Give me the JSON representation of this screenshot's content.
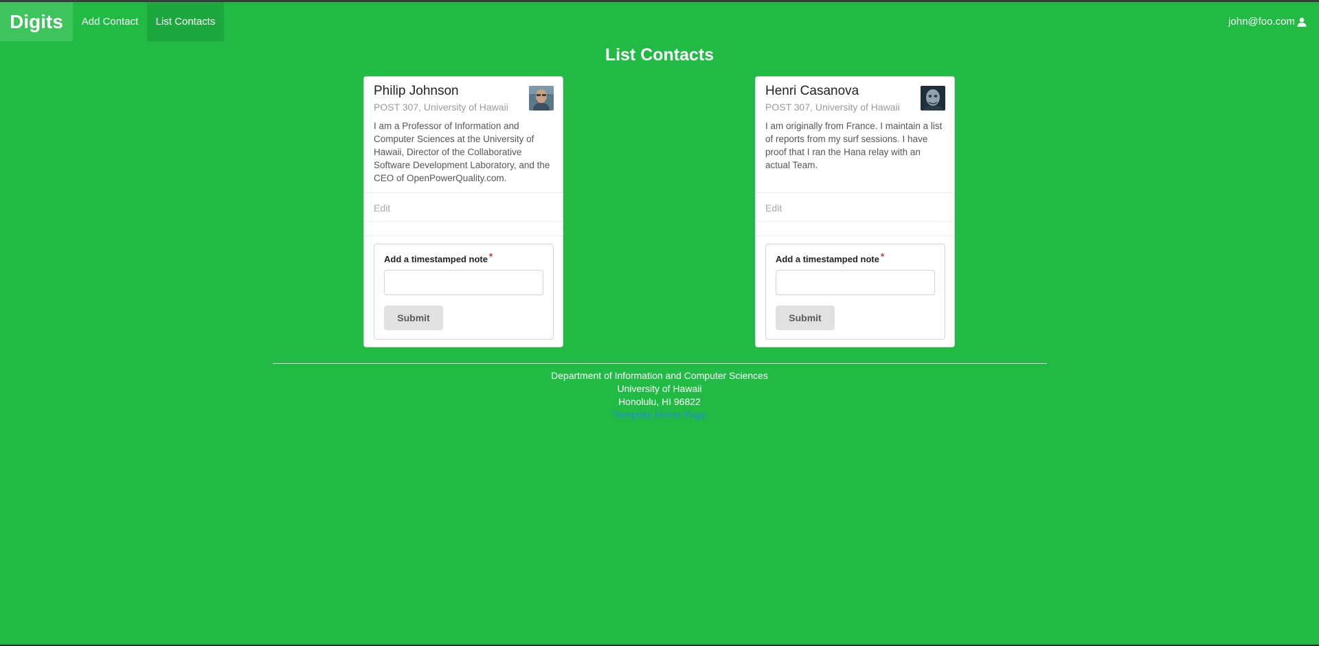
{
  "navbar": {
    "brand": "Digits",
    "items": [
      {
        "label": "Add Contact"
      },
      {
        "label": "List Contacts"
      }
    ],
    "user_email": "john@foo.com",
    "user_icon": "user-icon"
  },
  "page": {
    "title": "List Contacts"
  },
  "contacts": [
    {
      "name": "Philip Johnson",
      "address": "POST 307, University of Hawaii",
      "description": "I am a Professor of Information and Computer Sciences at the University of Hawaii, Director of the Collaborative Software Development Laboratory, and the CEO of OpenPowerQuality.com.",
      "edit_label": "Edit",
      "note_label": "Add a timestamped note",
      "required_mark": "*",
      "note_value": "",
      "submit_label": "Submit"
    },
    {
      "name": "Henri Casanova",
      "address": "POST 307, University of Hawaii",
      "description": "I am originally from France. I maintain a list of reports from my surf sessions. I have proof that I ran the Hana relay with an actual Team.",
      "edit_label": "Edit",
      "note_label": "Add a timestamped note",
      "required_mark": "*",
      "note_value": "",
      "submit_label": "Submit"
    }
  ],
  "footer": {
    "line1": "Department of Information and Computer Sciences",
    "line2": "University of Hawaii",
    "line3": "Honolulu, HI 96822",
    "link": "Template Home Page"
  },
  "colors": {
    "background": "#21ba45",
    "nav_active": "#1ea73f",
    "brand_bg": "#3ec45d",
    "link": "#1e90d6",
    "required": "#db2828"
  }
}
